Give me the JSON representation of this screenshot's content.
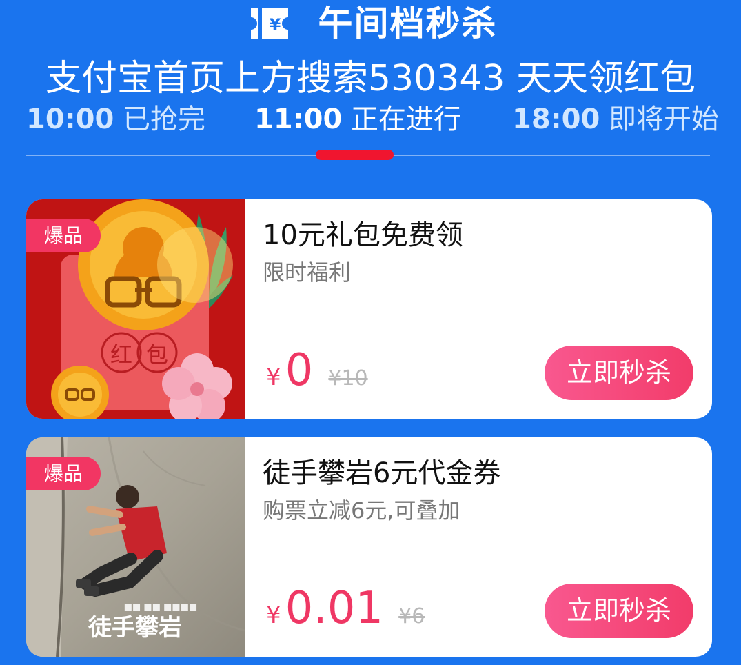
{
  "header": {
    "title": "午间档秒杀",
    "icon": "ticket-yuan-icon",
    "promo_text": "支付宝首页上方搜索530343 天天领红包"
  },
  "tabs": [
    {
      "time": "10:00",
      "status": "已抢完",
      "active": false
    },
    {
      "time": "11:00",
      "status": "正在进行",
      "active": true
    },
    {
      "time": "18:00",
      "status": "即将开始",
      "active": false
    }
  ],
  "deals": [
    {
      "badge": "爆品",
      "image": "red-envelope-coin-icon",
      "image_text": "红包",
      "title": "10元礼包免费领",
      "subtitle": "限时福利",
      "currency": "¥",
      "price": "0",
      "original_price": "¥10",
      "button": "立即秒杀"
    },
    {
      "badge": "爆品",
      "image": "rock-climber-poster",
      "image_text": "徒手攀岩",
      "title": "徒手攀岩6元代金券",
      "subtitle": "购票立减6元,可叠加",
      "currency": "¥",
      "price": "0.01",
      "original_price": "¥6",
      "button": "立即秒杀"
    }
  ],
  "colors": {
    "background": "#1a74ee",
    "accent_red": "#f0152f",
    "price_pink": "#ef3764",
    "badge_pink": "#f23663",
    "button_pink": "#f9588f"
  }
}
